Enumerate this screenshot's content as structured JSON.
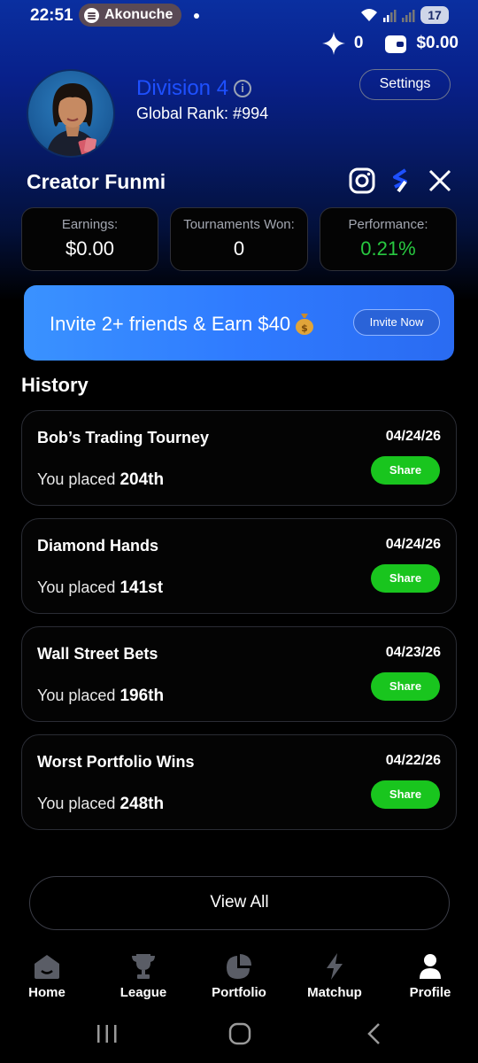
{
  "status_bar": {
    "time": "22:51",
    "media_app": "Akonuche",
    "battery": "17"
  },
  "balance": {
    "points": "0",
    "cash": "$0.00"
  },
  "profile": {
    "division": "Division 4",
    "global_rank": "Global Rank: #994",
    "settings_label": "Settings",
    "username": "Creator Funmi"
  },
  "stats": {
    "earnings_label": "Earnings:",
    "earnings_value": "$0.00",
    "tournaments_label": "Tournaments Won:",
    "tournaments_value": "0",
    "performance_label": "Performance:",
    "performance_value": "0.21%"
  },
  "invite": {
    "text": "Invite 2+ friends & Earn $40",
    "button_label": "Invite Now"
  },
  "history": {
    "title": "History",
    "placed_prefix": "You placed",
    "share_label": "Share",
    "items": [
      {
        "name": "Bob’s Trading Tourney",
        "date": "04/24/26",
        "rank": "204th"
      },
      {
        "name": "Diamond Hands",
        "date": "04/24/26",
        "rank": "141st"
      },
      {
        "name": "Wall Street Bets",
        "date": "04/23/26",
        "rank": "196th"
      },
      {
        "name": "Worst Portfolio Wins",
        "date": "04/22/26",
        "rank": "248th"
      }
    ],
    "view_all_label": "View All"
  },
  "nav": {
    "items": [
      {
        "label": "Home",
        "icon": "home-icon"
      },
      {
        "label": "League",
        "icon": "trophy-icon"
      },
      {
        "label": "Portfolio",
        "icon": "pie-chart-icon"
      },
      {
        "label": "Matchup",
        "icon": "lightning-icon"
      },
      {
        "label": "Profile",
        "icon": "person-icon"
      }
    ],
    "active": "Profile"
  },
  "colors": {
    "accent_blue": "#1e50ff",
    "share_green": "#19c51e",
    "performance_green": "#28c840"
  }
}
